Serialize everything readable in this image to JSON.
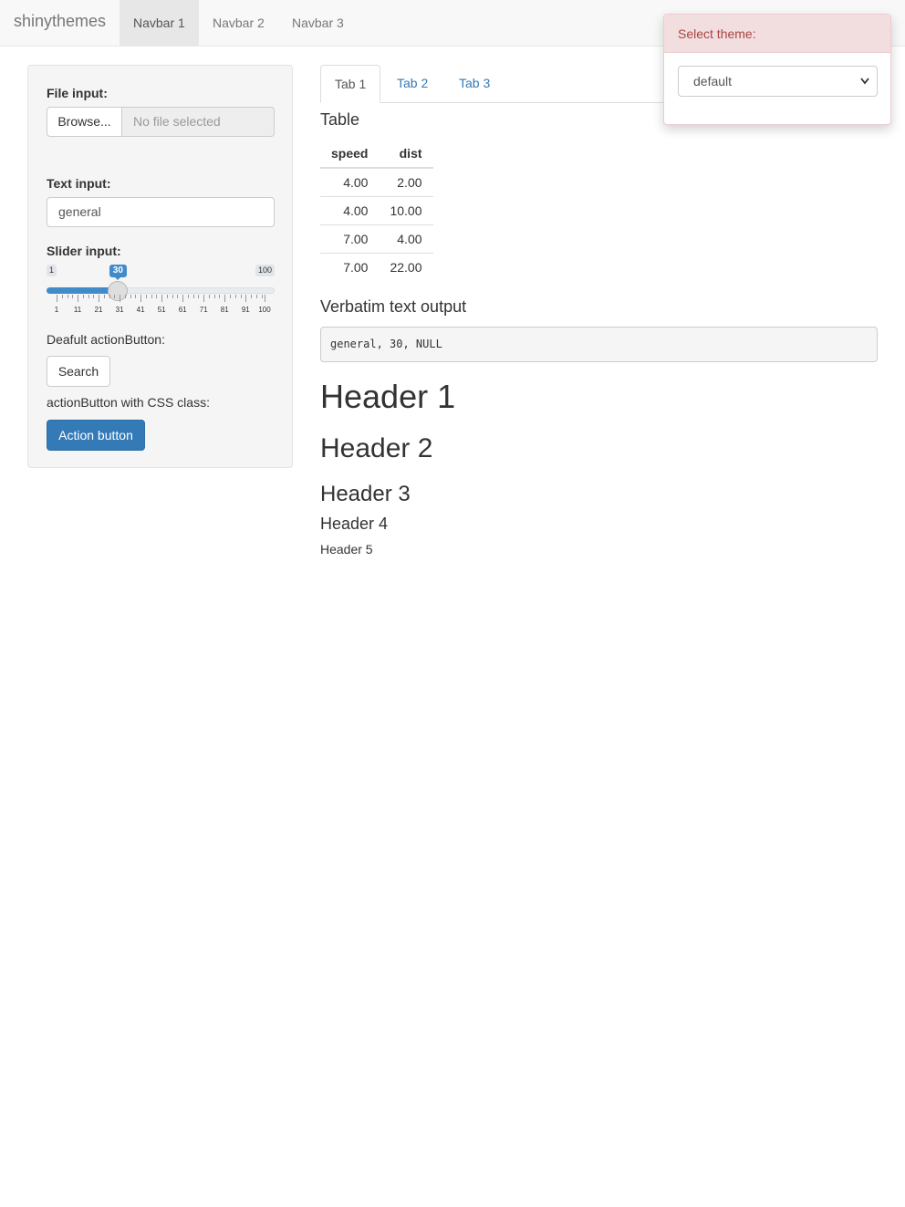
{
  "navbar": {
    "brand": "shinythemes",
    "items": [
      {
        "label": "Navbar 1",
        "active": true
      },
      {
        "label": "Navbar 2",
        "active": false
      },
      {
        "label": "Navbar 3",
        "active": false
      }
    ]
  },
  "sidebar": {
    "file_input": {
      "label": "File input:",
      "button": "Browse...",
      "placeholder": "No file selected"
    },
    "text_input": {
      "label": "Text input:",
      "value": "general"
    },
    "slider": {
      "label": "Slider input:",
      "min": 1,
      "max": 100,
      "value": 30,
      "min_label": "1",
      "max_label": "100",
      "value_label": "30",
      "tick_labels": [
        "1",
        "11",
        "21",
        "31",
        "41",
        "51",
        "61",
        "71",
        "81",
        "91",
        "100"
      ]
    },
    "default_button": {
      "caption": "Deafult actionButton:",
      "label": "Search"
    },
    "css_button": {
      "caption": "actionButton with CSS class:",
      "label": "Action button"
    }
  },
  "tabs": [
    {
      "label": "Tab 1",
      "active": true
    },
    {
      "label": "Tab 2",
      "active": false
    },
    {
      "label": "Tab 3",
      "active": false
    }
  ],
  "table": {
    "heading": "Table",
    "columns": [
      "speed",
      "dist"
    ],
    "rows": [
      [
        "4.00",
        "2.00"
      ],
      [
        "4.00",
        "10.00"
      ],
      [
        "7.00",
        "4.00"
      ],
      [
        "7.00",
        "22.00"
      ]
    ]
  },
  "verbatim": {
    "heading": "Verbatim text output",
    "text": "general, 30, NULL"
  },
  "headers": {
    "h1": "Header 1",
    "h2": "Header 2",
    "h3": "Header 3",
    "h4": "Header 4",
    "h5": "Header 5"
  },
  "theme_selector": {
    "title": "Select theme:",
    "selected": "default"
  },
  "colors": {
    "primary": "#337ab7",
    "slider": "#428bca",
    "danger_bg": "#f2dede",
    "danger_text": "#a94442"
  }
}
